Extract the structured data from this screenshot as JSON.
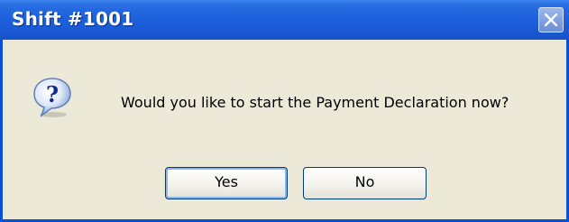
{
  "window": {
    "title": "Shift #1001",
    "close_icon": "close-icon"
  },
  "message": {
    "icon": "question-icon",
    "text": "Would you like to start the Payment Declaration now?"
  },
  "buttons": {
    "yes_label": "Yes",
    "no_label": "No"
  },
  "colors": {
    "titlebar": "#1f62dd",
    "window_border": "#0a4fd6",
    "dialog_background": "#ece9d8"
  }
}
